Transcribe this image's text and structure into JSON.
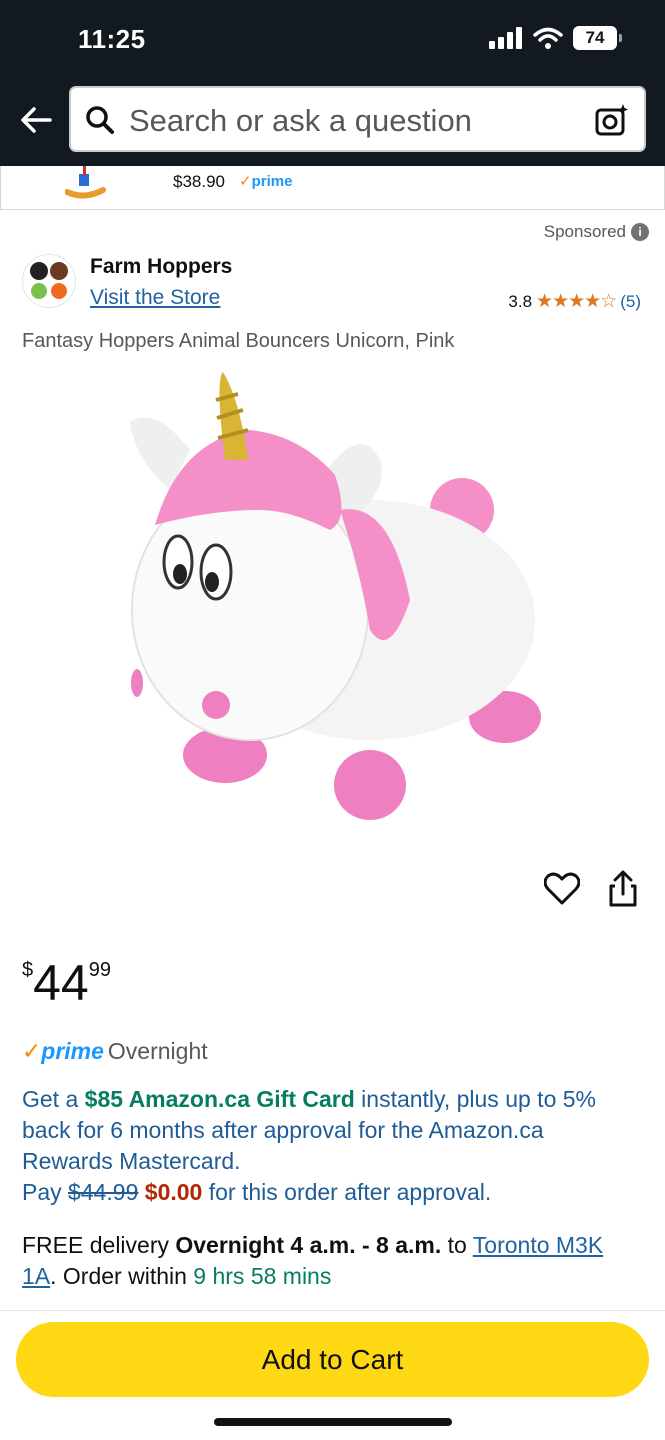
{
  "status_bar": {
    "time": "11:25",
    "battery": "74",
    "icons": [
      "signal-icon",
      "wifi-icon",
      "battery-icon"
    ]
  },
  "header": {
    "search_placeholder": "Search or ask a question",
    "icons": [
      "back-arrow-icon",
      "search-icon",
      "camera-icon"
    ]
  },
  "previous_item": {
    "price": "$38.90",
    "prime": "prime"
  },
  "sponsored": {
    "label": "Sponsored"
  },
  "brand": {
    "name": "Farm Hoppers",
    "visit_store": "Visit the Store"
  },
  "rating": {
    "value": "3.8",
    "stars": "★★★★☆",
    "stars_value": 3.8,
    "count": "(5)"
  },
  "product": {
    "title": "Fantasy Hoppers Animal Bouncers Unicorn, Pink"
  },
  "price": {
    "symbol": "$",
    "whole": "44",
    "fraction": "99"
  },
  "prime_delivery": {
    "check": "✓",
    "prime": "prime",
    "speed": "Overnight"
  },
  "offer": {
    "line1_a": "Get a ",
    "line1_b": "$85 Amazon.ca Gift Card",
    "line1_c": " instantly, plus up to 5% back for 6 months after approval for the Amazon.ca Rewards Mastercard.",
    "pay": "Pay ",
    "old_price": "$44.99",
    "new_price": "$0.00",
    "pay_rest": " for this order after approval."
  },
  "delivery": {
    "free": "FREE delivery ",
    "window": "Overnight 4 a.m. - 8 a.m.",
    "to": " to ",
    "location": "Toronto M3K 1A",
    "order_within": ". Order within ",
    "countdown": "9 hrs 58 mins"
  },
  "cart": {
    "label": "Add to Cart"
  },
  "colors": {
    "header_bg": "#131921",
    "cart_yellow": "#ffd814",
    "link_blue": "#2162a1",
    "prime_blue": "#1a98ff",
    "deal_red": "#b12704",
    "green": "#067d62",
    "star_orange": "#de7921"
  }
}
